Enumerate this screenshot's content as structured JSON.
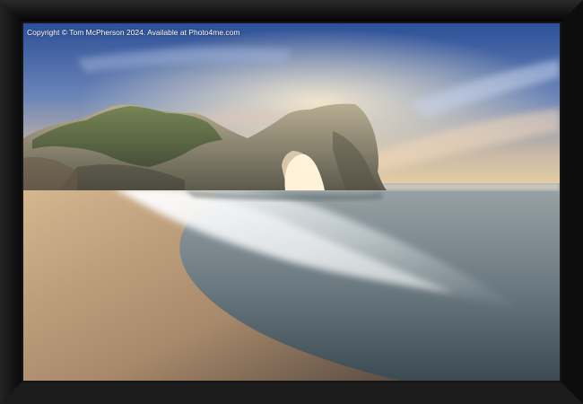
{
  "watermark": {
    "copyright_text": "Copyright © Tom McPherson 2024. Available at Photo4me.com"
  },
  "frame": {
    "color": "#121212"
  },
  "scene": {
    "sky_top_color": "#2f57a3",
    "sky_horizon_color": "#e8cfa8",
    "sea_color": "#8e9aa0",
    "sand_color": "#b89b7a",
    "rock_color": "#8a8a74"
  }
}
